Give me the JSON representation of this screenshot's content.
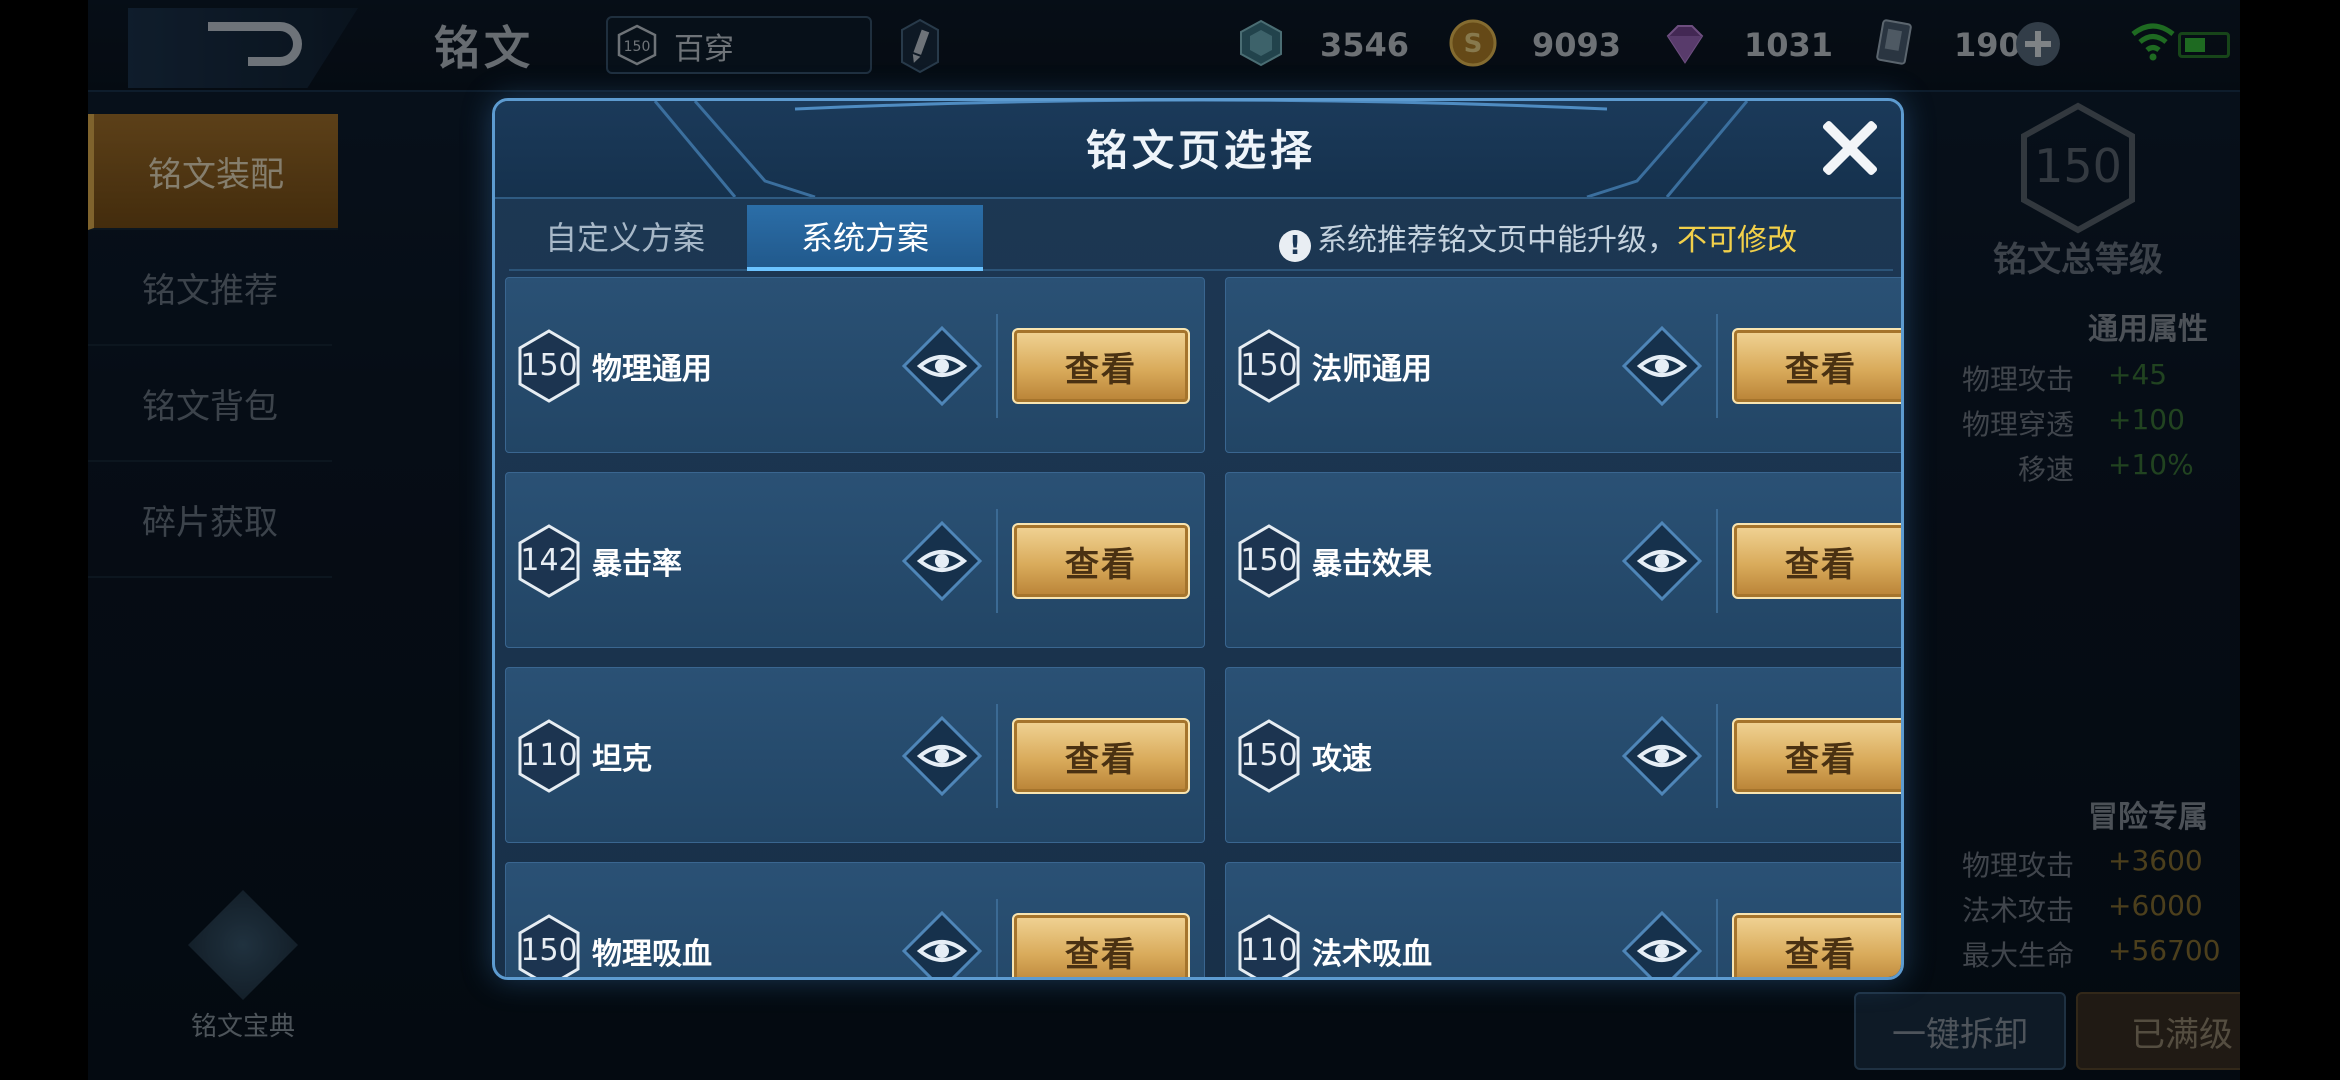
{
  "header": {
    "title": "铭文",
    "page_level": "150",
    "page_name": "百穿",
    "resources": [
      {
        "icon": "crystal-icon",
        "value": "3546"
      },
      {
        "icon": "gold-coin-icon",
        "value": "9093"
      },
      {
        "icon": "gem-icon",
        "value": "1031"
      },
      {
        "icon": "card-icon",
        "value": "190"
      }
    ]
  },
  "sidebar": {
    "items": [
      {
        "label": "铭文装配",
        "active": true
      },
      {
        "label": "铭文推荐",
        "active": false
      },
      {
        "label": "铭文背包",
        "active": false
      },
      {
        "label": "碎片获取",
        "active": false
      }
    ],
    "codex_label": "铭文宝典"
  },
  "right_panel": {
    "total_level": "150",
    "total_label": "铭文总等级",
    "common_header": "通用属性",
    "common_attrs": [
      {
        "key": "物理攻击",
        "value": "+45"
      },
      {
        "key": "物理穿透",
        "value": "+100"
      },
      {
        "key": "移速",
        "value": "+10%"
      }
    ],
    "adventure_header": "冒险专属",
    "adventure_attrs": [
      {
        "key": "物理攻击",
        "value": "+3600"
      },
      {
        "key": "法术攻击",
        "value": "+6000"
      },
      {
        "key": "最大生命",
        "value": "+56700"
      }
    ],
    "dismount_label": "一键拆卸",
    "full_label": "已满级"
  },
  "modal": {
    "title": "铭文页选择",
    "tabs": [
      {
        "label": "自定义方案",
        "active": false
      },
      {
        "label": "系统方案",
        "active": true
      }
    ],
    "notice_text": "系统推荐铭文页中能升级，",
    "notice_highlight": "不可修改",
    "view_label": "查看",
    "cards": [
      {
        "level": "150",
        "name": "物理通用"
      },
      {
        "level": "150",
        "name": "法师通用"
      },
      {
        "level": "142",
        "name": "暴击率"
      },
      {
        "level": "150",
        "name": "暴击效果"
      },
      {
        "level": "110",
        "name": "坦克"
      },
      {
        "level": "150",
        "name": "攻速"
      },
      {
        "level": "150",
        "name": "物理吸血"
      },
      {
        "level": "110",
        "name": "法术吸血"
      }
    ]
  }
}
